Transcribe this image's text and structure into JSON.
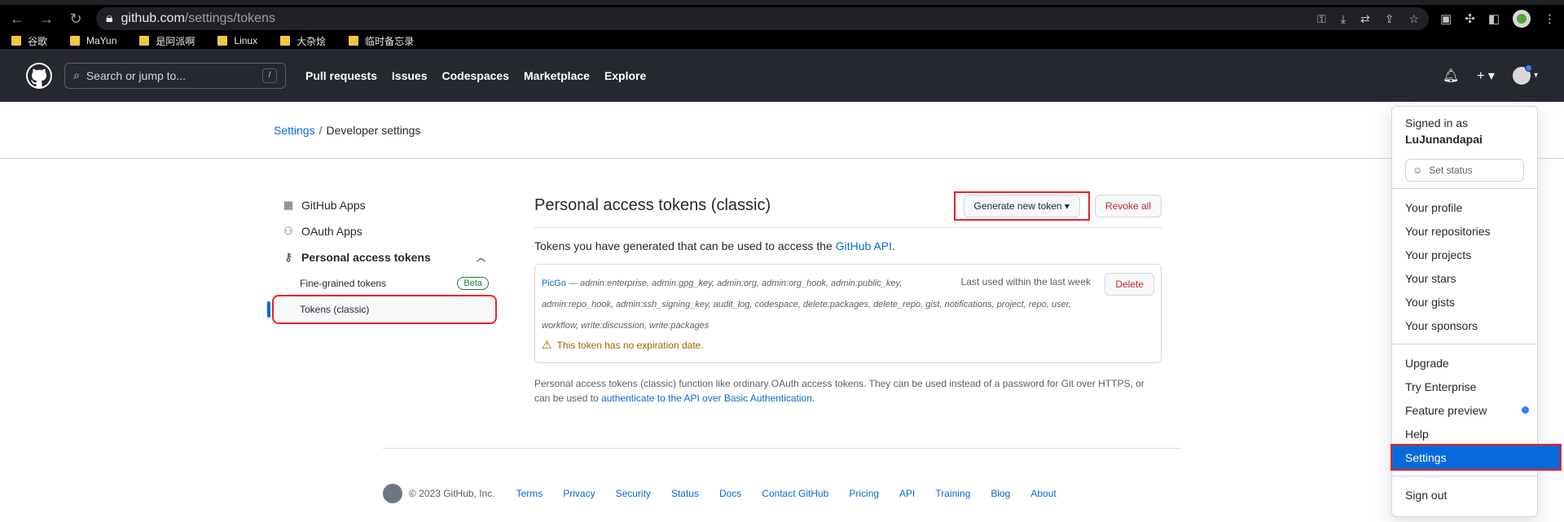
{
  "browser": {
    "url_host": "github.com",
    "url_path": "/settings/tokens",
    "bookmarks": [
      "谷歌",
      "MaYun",
      "是阿派啊",
      "Linux",
      "大杂烩",
      "临时备忘录"
    ]
  },
  "header": {
    "search_placeholder": "Search or jump to...",
    "search_key": "/",
    "nav": [
      "Pull requests",
      "Issues",
      "Codespaces",
      "Marketplace",
      "Explore"
    ]
  },
  "breadcrumb": {
    "settings": "Settings",
    "sep": "/",
    "current": "Developer settings"
  },
  "sidebar": {
    "github_apps": "GitHub Apps",
    "oauth_apps": "OAuth Apps",
    "pat": "Personal access tokens",
    "fine_grained": "Fine-grained tokens",
    "beta": "Beta",
    "classic": "Tokens (classic)"
  },
  "content": {
    "title": "Personal access tokens (classic)",
    "generate_btn": "Generate new token ▾",
    "revoke_btn": "Revoke all",
    "intro_text": "Tokens you have generated that can be used to access the ",
    "intro_link": "GitHub API",
    "intro_end": ".",
    "token": {
      "name": "PicGo",
      "scopes_line1": " — admin:enterprise, admin:gpg_key, admin:org, admin:org_hook, admin:public_key,",
      "scopes_line2": "admin:repo_hook, admin:ssh_signing_key, audit_log, codespace, delete:packages, delete_repo, gist, notifications, project, repo, user,",
      "scopes_line3": "workflow, write:discussion, write:packages",
      "last_used": "Last used within the last week",
      "delete": "Delete",
      "warning": "This token has no expiration date."
    },
    "note_text": "Personal access tokens (classic) function like ordinary OAuth access tokens. They can be used instead of a password for Git over HTTPS, or can be used to ",
    "note_link": "authenticate to the API over Basic Authentication",
    "note_end": "."
  },
  "footer": {
    "copyright": "© 2023 GitHub, Inc.",
    "links": [
      "Terms",
      "Privacy",
      "Security",
      "Status",
      "Docs",
      "Contact GitHub",
      "Pricing",
      "API",
      "Training",
      "Blog",
      "About"
    ]
  },
  "dropdown": {
    "signed_in_as": "Signed in as",
    "username": "LuJunandapai",
    "set_status": "Set status",
    "group1": [
      "Your profile",
      "Your repositories",
      "Your projects",
      "Your stars",
      "Your gists",
      "Your sponsors"
    ],
    "group2": [
      "Upgrade",
      "Try Enterprise",
      "Feature preview",
      "Help",
      "Settings"
    ],
    "sign_out": "Sign out"
  },
  "colors": {
    "accent": "#0969da",
    "header_bg": "#24292f",
    "danger": "#cf222e",
    "highlight_box": "#ee2222"
  }
}
